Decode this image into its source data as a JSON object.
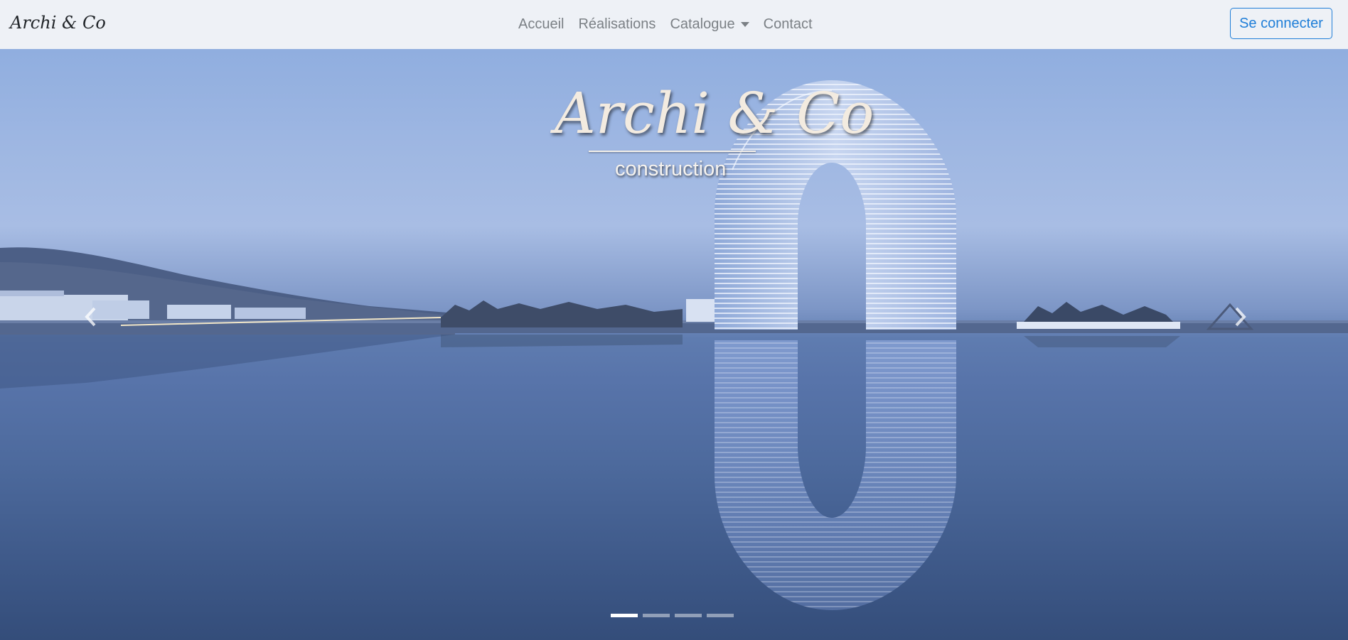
{
  "navbar": {
    "brand": "Archi & Co",
    "links": [
      {
        "label": "Accueil"
      },
      {
        "label": "Réalisations"
      },
      {
        "label": "Catalogue"
      },
      {
        "label": "Contact"
      }
    ],
    "login_label": "Se connecter"
  },
  "hero": {
    "title": "Archi & Co",
    "subtitle": "construction",
    "prev_icon": "chevron-left-icon",
    "next_icon": "chevron-right-icon",
    "slide_count": 4,
    "active_slide": 1
  },
  "colors": {
    "primary": "#1f7ed8",
    "navbar_bg": "#eef1f6",
    "nav_text": "#7b8085"
  }
}
